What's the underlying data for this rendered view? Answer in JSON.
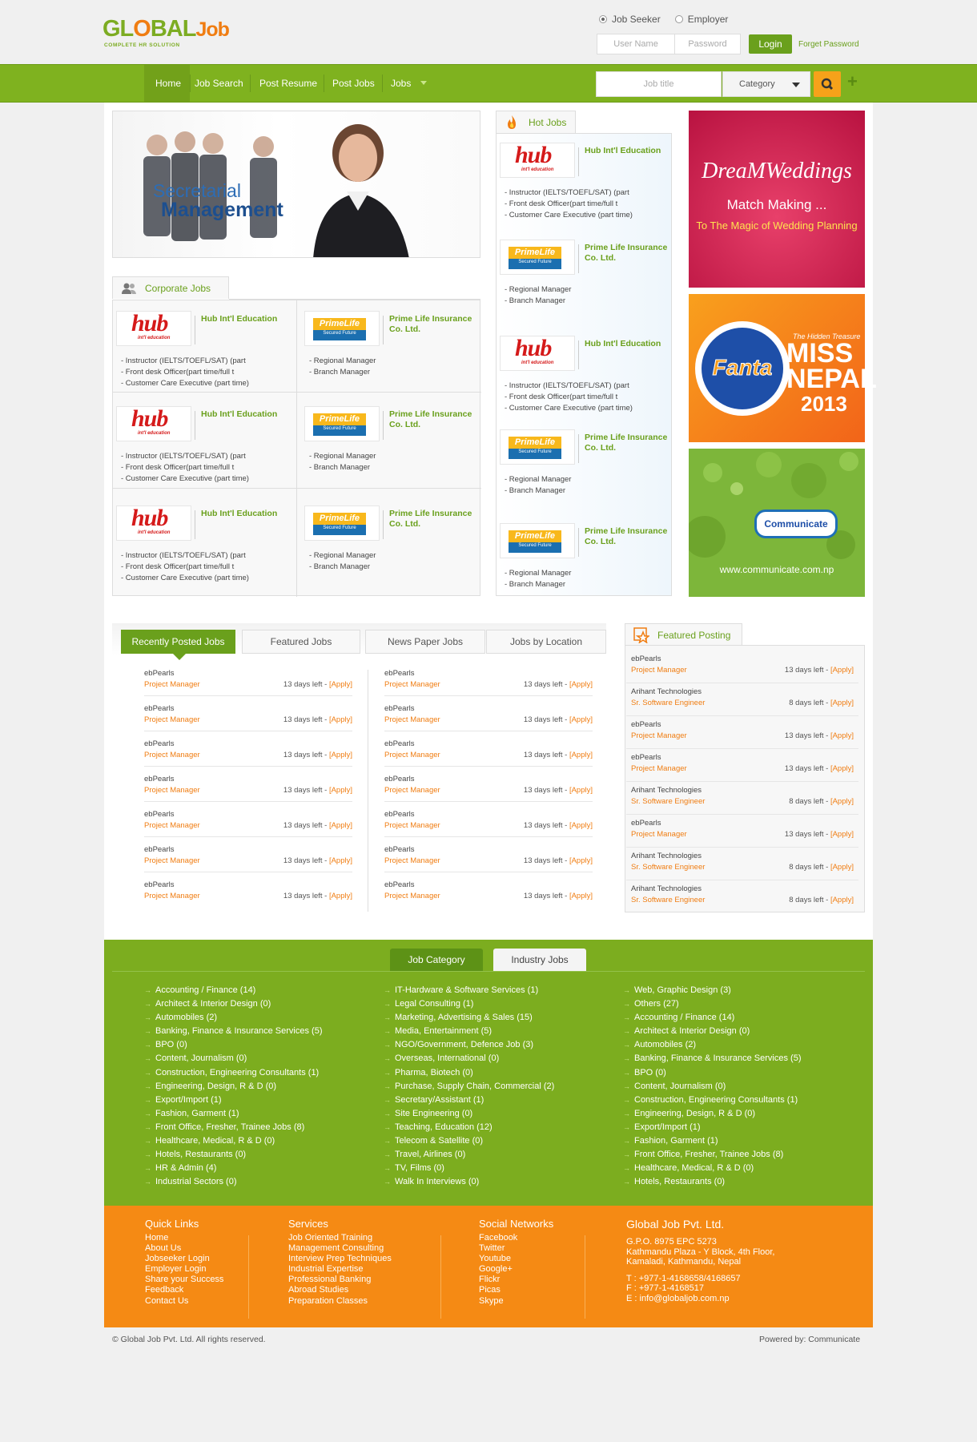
{
  "header": {
    "logo_main": "GL BAL",
    "logo_o": "O",
    "logo_job": "Job",
    "logo_tagline": "COMPLETE HR SOLUTION",
    "radio_jobseeker": "Job Seeker",
    "radio_employer": "Employer",
    "username_placeholder": "User Name",
    "password_placeholder": "Password",
    "login_label": "Login",
    "forget_label": "Forget Password"
  },
  "nav": {
    "items": [
      "Home",
      "Job Search",
      "Post Resume",
      "Post Jobs",
      "Jobs"
    ],
    "search_placeholder": "Job title",
    "category_label": "Category"
  },
  "banner": {
    "line1": "Secretarial",
    "line2": "Management"
  },
  "corporate": {
    "title": "Corporate Jobs",
    "hub_name": "Hub Int'l Education",
    "hub_logo": "hub",
    "hub_logo_sub": "int'l education",
    "hub_lines": [
      "- Instructor (IELTS/TOEFL/SAT) (part",
      "- Front desk Officer(part time/full t",
      "- Customer Care Executive (part time)"
    ],
    "prime_name": "Prime Life Insurance Co. Ltd.",
    "prime_logo": "PrimeLife",
    "prime_logo_sub": "Secured Future",
    "prime_lines": [
      "- Regional Manager",
      "- Branch Manager"
    ]
  },
  "hot": {
    "title": "Hot Jobs"
  },
  "ads": {
    "wedding_title": "DreaMWeddings",
    "wedding_line1": "Match Making ...",
    "wedding_line2": "To The Magic of Wedding Planning",
    "fanta_brand": "Fanta",
    "fanta_small": "The Hidden Treasure",
    "fanta_line1": "MISS",
    "fanta_line2": "NEPAL",
    "fanta_line3": "2013",
    "comm_bubble": "Communicate",
    "comm_url": "www.communicate.com.np"
  },
  "tabs": [
    "Recently Posted Jobs",
    "Featured Jobs",
    "News Paper Jobs",
    "Jobs by Location"
  ],
  "recent": {
    "company": "ebPearls",
    "title": "Project Manager",
    "days": "13 days left - ",
    "apply": "[Apply]"
  },
  "featured": {
    "title": "Featured Posting",
    "rows": [
      {
        "company": "ebPearls",
        "title": "Project Manager",
        "days": "13 days left - ",
        "apply": "[Apply]"
      },
      {
        "company": "Arihant Technologies",
        "title": "Sr. Software Engineer",
        "days": "8 days left - ",
        "apply": "[Apply]"
      },
      {
        "company": "ebPearls",
        "title": "Project Manager",
        "days": "13 days left - ",
        "apply": "[Apply]"
      },
      {
        "company": "ebPearls",
        "title": "Project Manager",
        "days": "13 days left - ",
        "apply": "[Apply]"
      },
      {
        "company": "Arihant Technologies",
        "title": "Sr. Software Engineer",
        "days": "8 days left - ",
        "apply": "[Apply]"
      },
      {
        "company": "ebPearls",
        "title": "Project Manager",
        "days": "13 days left - ",
        "apply": "[Apply]"
      },
      {
        "company": "Arihant Technologies",
        "title": "Sr. Software Engineer",
        "days": "8 days left - ",
        "apply": "[Apply]"
      },
      {
        "company": "Arihant Technologies",
        "title": "Sr. Software Engineer",
        "days": "8 days left - ",
        "apply": "[Apply]"
      }
    ]
  },
  "category": {
    "tab_job": "Job Category",
    "tab_industry": "Industry Jobs",
    "col1": [
      "Accounting / Finance (14)",
      "Architect & Interior Design (0)",
      "Automobiles (2)",
      "Banking, Finance & Insurance Services (5)",
      "BPO (0)",
      "Content, Journalism (0)",
      "Construction, Engineering Consultants (1)",
      "Engineering, Design, R & D (0)",
      "Export/Import (1)",
      "Fashion, Garment (1)",
      "Front Office, Fresher, Trainee Jobs (8)",
      "Healthcare, Medical, R & D (0)",
      "Hotels, Restaurants (0)",
      "HR & Admin (4)",
      "Industrial Sectors (0)"
    ],
    "col2": [
      "IT-Hardware & Software Services (1)",
      "Legal Consulting (1)",
      "Marketing, Advertising & Sales (15)",
      "Media, Entertainment (5)",
      "NGO/Government, Defence Job (3)",
      "Overseas, International (0)",
      "Pharma, Biotech (0)",
      "Purchase, Supply Chain, Commercial (2)",
      "Secretary/Assistant (1)",
      "Site Engineering (0)",
      "Teaching, Education (12)",
      "Telecom & Satellite (0)",
      "Travel, Airlines (0)",
      "TV, Films (0)",
      "Walk In Interviews (0)"
    ],
    "col3": [
      "Web, Graphic Design (3)",
      "Others (27)",
      "Accounting / Finance (14)",
      "Architect & Interior Design (0)",
      "Automobiles (2)",
      "Banking, Finance & Insurance Services (5)",
      "BPO (0)",
      "Content, Journalism (0)",
      "Construction, Engineering Consultants (1)",
      "Engineering, Design, R & D (0)",
      "Export/Import (1)",
      "Fashion, Garment (1)",
      "Front Office, Fresher, Trainee Jobs (8)",
      "Healthcare, Medical, R & D (0)",
      "Hotels, Restaurants (0)"
    ]
  },
  "footer": {
    "quick_title": "Quick Links",
    "quick": [
      "Home",
      "About Us",
      "Jobseeker Login",
      "Employer Login",
      "Share your Success",
      "Feedback",
      "Contact Us"
    ],
    "services_title": "Services",
    "services": [
      "Job Oriented Training",
      "Management Consulting",
      "Interview Prep Techniques",
      "Industrial Expertise",
      "Professional Banking",
      "Abroad Studies",
      "Preparation Classes"
    ],
    "social_title": "Social Networks",
    "social": [
      "Facebook",
      "Twitter",
      "Youtube",
      "Google+",
      "Flickr",
      "Picas",
      "Skype"
    ],
    "company_title": "Global Job Pvt. Ltd.",
    "address": [
      "G.P.O. 8975 EPC 5273",
      "Kathmandu Plaza - Y Block, 4th Floor,",
      "Kamaladi, Kathmandu, Nepal"
    ],
    "contact": [
      "T : +977-1-4168658/4168657",
      "F : +977-1-4168517",
      "E : info@globaljob.com.np"
    ],
    "copyright": "© Global Job Pvt. Ltd. All rights reserved.",
    "powered": "Powered by: Communicate"
  },
  "colors": {
    "green": "#7cad1f",
    "orange": "#f58a14",
    "accent": "#6aa01c"
  }
}
